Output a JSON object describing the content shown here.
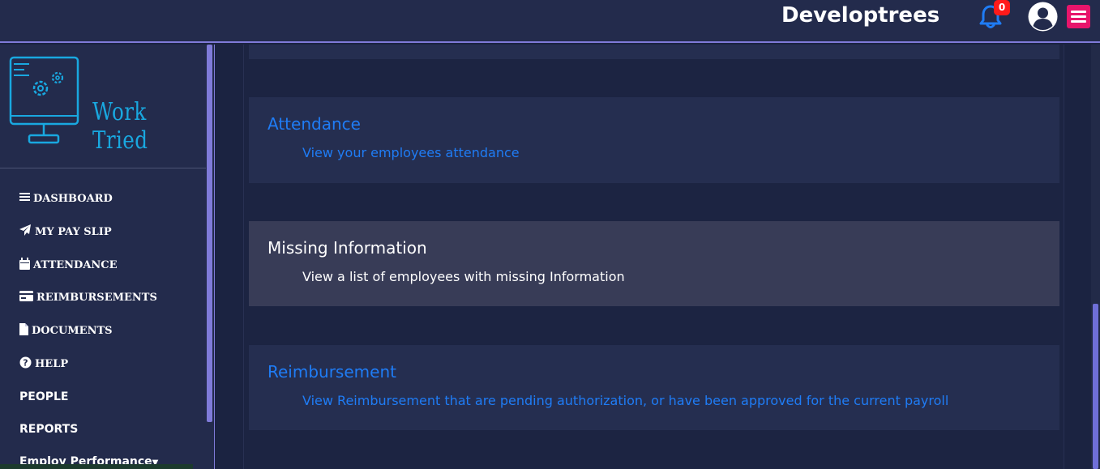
{
  "header": {
    "brand": "Developtrees",
    "notification_count": "0"
  },
  "sidebar": {
    "logo_text": "Work Tried",
    "items": [
      {
        "label": "DASHBOARD",
        "icon": "bars-icon"
      },
      {
        "label": "MY PAY SLIP",
        "icon": "paper-plane-icon"
      },
      {
        "label": "ATTENDANCE",
        "icon": "calendar-icon"
      },
      {
        "label": "REIMBURSEMENTS",
        "icon": "credit-card-icon"
      },
      {
        "label": "DOCUMENTS",
        "icon": "file-icon"
      },
      {
        "label": "HELP",
        "icon": "question-circle-icon"
      }
    ],
    "plain_items": [
      {
        "label": "PEOPLE"
      },
      {
        "label": "REPORTS"
      },
      {
        "label": "Employ Performance"
      }
    ]
  },
  "cards": [
    {
      "title": "Attendance",
      "desc": "View your employees attendance"
    },
    {
      "title": "Missing Information",
      "desc": "View a list of employees with missing Information"
    },
    {
      "title": "Reimbursement",
      "desc": "View Reimbursement that are pending authorization, or have been approved for the current payroll"
    }
  ],
  "colors": {
    "accent": "#1f7cf5",
    "header_bg": "#232b4c",
    "page_bg": "#1b2341",
    "card_bg": "#252e50",
    "card_active_bg": "#383c57",
    "badge": "#ff1a1a",
    "menu_button": "#e7156b",
    "logo": "#19a8e0",
    "border_accent": "#7f7bd9"
  }
}
